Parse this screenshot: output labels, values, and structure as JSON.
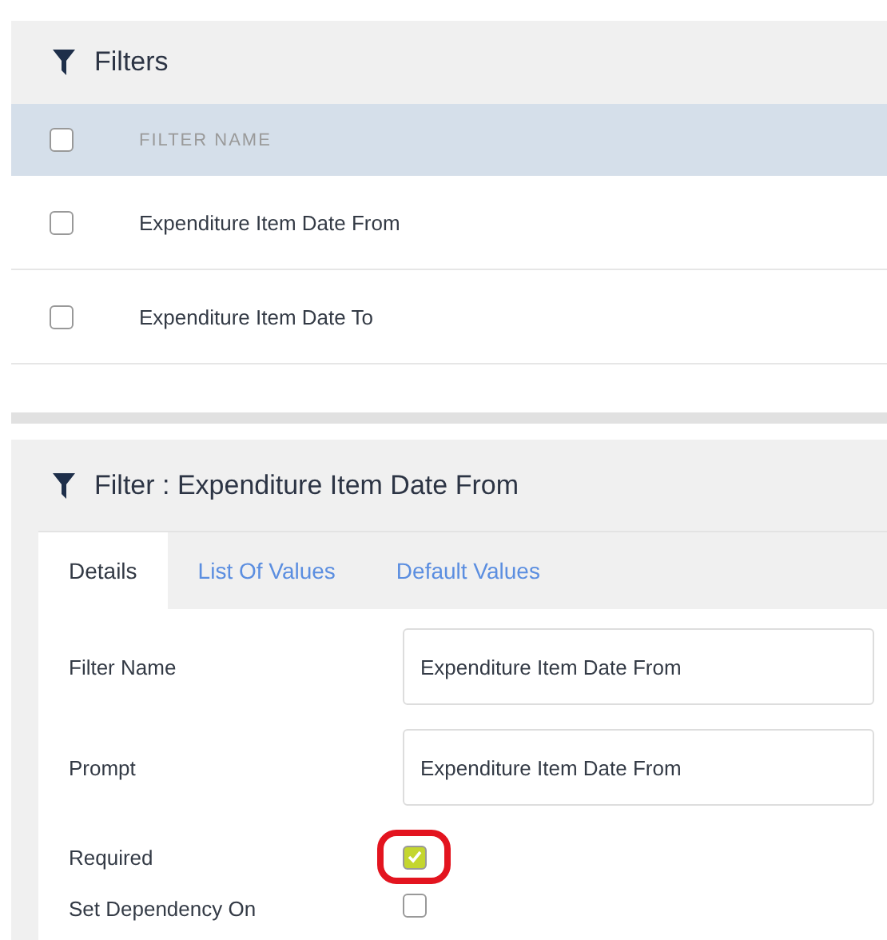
{
  "filters_panel": {
    "title": "Filters",
    "header": {
      "checked": false,
      "column": "FILTER NAME"
    },
    "rows": [
      {
        "name": "Expenditure Item Date From",
        "checked": false
      },
      {
        "name": "Expenditure Item Date To",
        "checked": false
      }
    ]
  },
  "detail_panel": {
    "title": "Filter : Expenditure Item Date From",
    "tabs": [
      {
        "label": "Details",
        "selected": true
      },
      {
        "label": "List Of Values",
        "selected": false
      },
      {
        "label": "Default Values",
        "selected": false
      }
    ],
    "fields": [
      {
        "kind": "text",
        "label": "Filter Name",
        "value": "Expenditure Item Date From"
      },
      {
        "kind": "text",
        "label": "Prompt",
        "value": "Expenditure Item Date From"
      },
      {
        "kind": "checkbox",
        "label": "Required",
        "checked": true,
        "highlighted": true
      },
      {
        "kind": "checkbox",
        "label": "Set Dependency On",
        "checked": false,
        "highlighted": false
      }
    ]
  }
}
